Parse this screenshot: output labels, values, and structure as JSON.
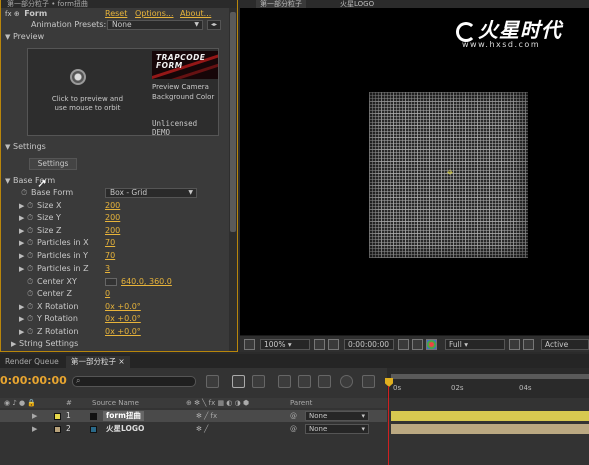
{
  "effect_panel": {
    "title": "第一部分粒子 • form扭曲",
    "effect_name": "Form",
    "reset_label": "Reset",
    "options_label": "Options...",
    "about_label": "About...",
    "animation_presets_label": "Animation Presets:",
    "animation_presets_value": "None",
    "preview_label": "Preview",
    "preview_orbit_text": "Click to preview and use mouse to orbit",
    "preview_logo_text": "TRAPCODE FORM",
    "preview_camera_label": "Preview Camera",
    "background_color_label": "Background Color",
    "unlicensed_text": "Unlicensed DEMO",
    "settings_group": "Settings",
    "settings_button": "Settings",
    "base_form_group": "Base Form",
    "base_form_label": "Base Form",
    "base_form_value": "Box - Grid",
    "properties": [
      {
        "label": "Size X",
        "value": "200"
      },
      {
        "label": "Size Y",
        "value": "200"
      },
      {
        "label": "Size Z",
        "value": "200"
      },
      {
        "label": "Particles in X",
        "value": "70"
      },
      {
        "label": "Particles in Y",
        "value": "70"
      },
      {
        "label": "Particles in Z",
        "value": "3"
      }
    ],
    "center_xy_label": "Center XY",
    "center_xy_value": "640.0, 360.0",
    "center_z_label": "Center Z",
    "center_z_value": "0",
    "rotations": [
      {
        "label": "X Rotation",
        "value": "0x +0.0°"
      },
      {
        "label": "Y Rotation",
        "value": "0x +0.0°"
      },
      {
        "label": "Z Rotation",
        "value": "0x +0.0°"
      }
    ],
    "string_settings_label": "String Settings"
  },
  "composition": {
    "tab_active": "第一部分粒子",
    "tab_other": "火星LOGO",
    "watermark_logo": "火星时代",
    "watermark_url": "www.hxsd.com",
    "toolbar": {
      "zoom": "100%",
      "timecode": "0:00:00:00",
      "resolution": "Full",
      "active_camera": "Active Came"
    }
  },
  "timeline": {
    "render_queue_tab": "Render Queue",
    "comp_tab": "第一部分粒子",
    "timecode": "0:00:00:00",
    "ruler_ticks": [
      "0s",
      "02s",
      "04s"
    ],
    "column_headers": {
      "number": "#",
      "source_name": "Source Name",
      "parent": "Parent"
    },
    "layers": [
      {
        "number": "1",
        "name": "form扭曲",
        "parent": "None",
        "label_color": "#e6d84a",
        "bar_color": "#d7c850"
      },
      {
        "number": "2",
        "name": "火星LOGO",
        "parent": "None",
        "label_color": "#b8a27a",
        "bar_color": "#bba982"
      }
    ]
  },
  "colors": {
    "accent_value": "#e8b43a",
    "panel_border": "#b8860b",
    "playhead": "#d02020"
  }
}
